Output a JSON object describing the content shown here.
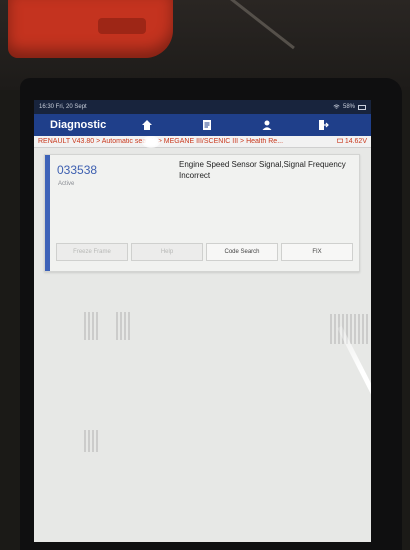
{
  "status_bar": {
    "time_date": "16:30  Fri, 20 Sept",
    "battery": "58%"
  },
  "app_bar": {
    "title": "Diagnostic",
    "nav_icons": [
      "home-icon",
      "report-icon",
      "user-icon",
      "exit-icon"
    ]
  },
  "breadcrumb": {
    "path": "RENAULT V43.80 > Automatic search > MEGANE III/SCENIC III > Health Re...",
    "voltage": "14.62V"
  },
  "dtc": {
    "code": "033538",
    "status": "Active",
    "description": "Engine Speed Sensor Signal,Signal Frequency Incorrect"
  },
  "buttons": {
    "freeze_frame": "Freeze Frame",
    "help": "Help",
    "code_search": "Code Search",
    "fix": "FIX"
  },
  "colors": {
    "app_bar": "#1f3f8a",
    "accent": "#3d62b8",
    "breadcrumb_text": "#c9391e",
    "dtc_code": "#3d5fb0"
  }
}
